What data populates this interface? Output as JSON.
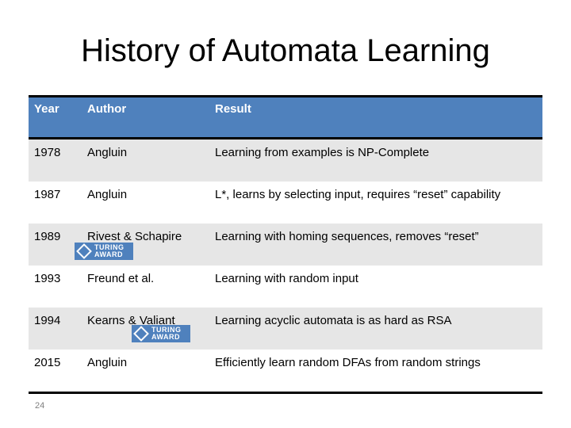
{
  "slide": {
    "title": "History of Automata Learning",
    "page_number": "24"
  },
  "table": {
    "headers": [
      "Year",
      "Author",
      "Result"
    ],
    "rows": [
      {
        "year": "1978",
        "author": "Angluin",
        "result": "Learning from examples  is NP-Complete",
        "badge": null
      },
      {
        "year": "1987",
        "author": "Angluin",
        "result": "L*, learns by selecting input, requires “reset” capability",
        "badge": null
      },
      {
        "year": "1989",
        "author": "Rivest & Schapire",
        "result": "Learning with homing sequences, removes “reset”",
        "badge": "turing-award"
      },
      {
        "year": "1993",
        "author": "Freund et al.",
        "result": "Learning with random input",
        "badge": null
      },
      {
        "year": "1994",
        "author": "Kearns & Valiant",
        "result": "Learning acyclic automata is as hard as RSA",
        "badge": "turing-award"
      },
      {
        "year": "2015",
        "author": "Angluin",
        "result": "Efficiently learn random DFAs from random strings",
        "badge": null
      }
    ],
    "badge_text": {
      "line1": "TURING",
      "line2": "AWARD"
    }
  },
  "colors": {
    "header": "#4f81bd",
    "band": "#e6e6e6"
  }
}
